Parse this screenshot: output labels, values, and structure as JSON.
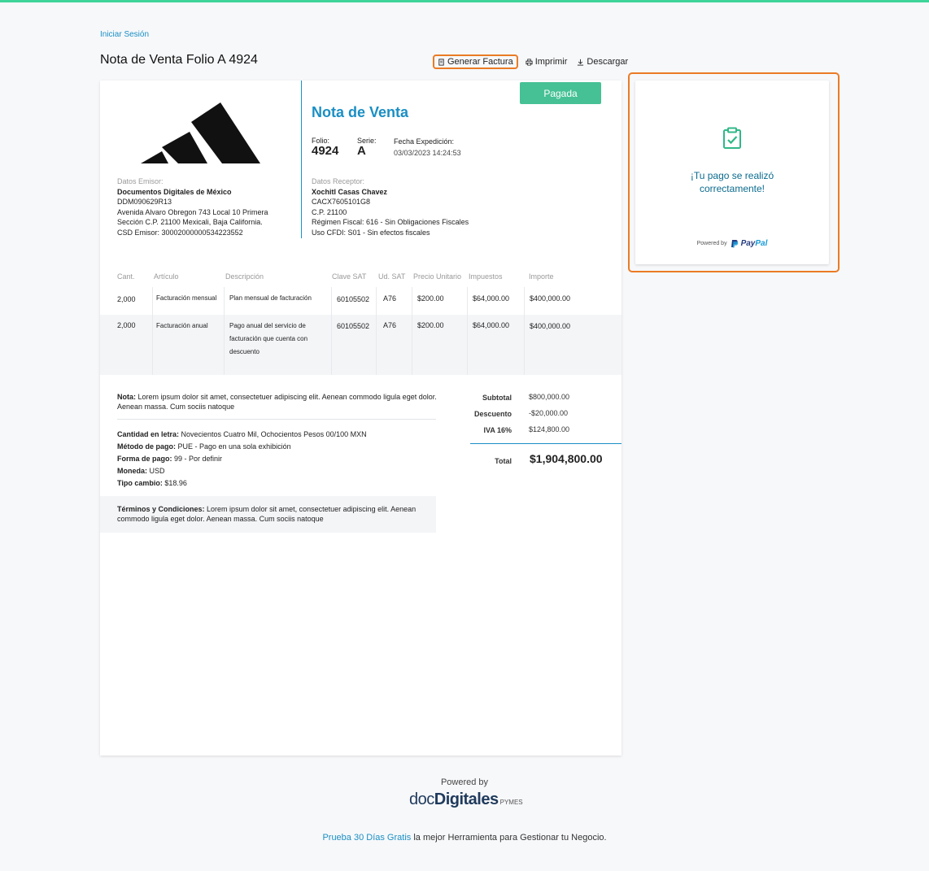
{
  "header": {
    "login_link": "Iniciar Sesión",
    "title": "Nota de Venta Folio A 4924",
    "actions": {
      "generate_invoice": "Generar Factura",
      "print": "Imprimir",
      "download": "Descargar"
    }
  },
  "colors": {
    "accent": "#1a8fc4",
    "status_green": "#45c195",
    "highlight": "#ea7b25",
    "top_bar": "#3ed49a"
  },
  "document": {
    "status_badge": "Pagada",
    "heading": "Nota de Venta",
    "folio_label": "Folio:",
    "folio": "4924",
    "serie_label": "Serie:",
    "serie": "A",
    "date_label": "Fecha Expedición:",
    "date": "03/03/2023 14:24:53",
    "emisor": {
      "label": "Datos Emisor:",
      "name": "Documentos Digitales de México",
      "rfc": "DDM090629R13",
      "address1": "Avenida Alvaro Obregon 743 Local 10 Primera",
      "address2": "Sección C.P. 21100 Mexicali, Baja California.",
      "csd": "CSD Emisor: 30002000000534223552"
    },
    "receptor": {
      "label": "Datos Receptor:",
      "name": "Xochitl Casas Chavez",
      "rfc": "CACX7605101G8",
      "cp": "C.P. 21100",
      "regimen": "Régimen Fiscal: 616 - Sin Obligaciones Fiscales",
      "uso": "Uso CFDI: S01 - Sin efectos fiscales"
    },
    "table": {
      "headers": [
        "Cant.",
        "Artículo",
        "Descripción",
        "Clave SAT",
        "Ud. SAT",
        "Precio Unitario",
        "Impuestos",
        "Importe"
      ],
      "rows": [
        {
          "cant": "2,000",
          "articulo": "Facturación mensual",
          "descripcion": "Plan mensual de facturación",
          "clave": "60105502",
          "unidad": "A76",
          "precio": "$200.00",
          "impuestos": "$64,000.00",
          "importe": "$400,000.00"
        },
        {
          "cant": "2,000",
          "articulo": "Facturación anual",
          "descripcion1": "Pago anual del servicio de",
          "descripcion2": "facturación que cuenta con",
          "descripcion3": "descuento",
          "clave": "60105502",
          "unidad": "A76",
          "precio": "$200.00",
          "impuestos": "$64,000.00",
          "importe": "$400,000.00"
        }
      ]
    },
    "note": {
      "label": "Nota:",
      "text": "Lorem ipsum dolor sit amet, consectetuer adipiscing elit. Aenean commodo ligula eget dolor. Aenean massa. Cum sociis natoque"
    },
    "info": {
      "amount_words_label": "Cantidad en letra:",
      "amount_words": "Novecientos Cuatro Mil, Ochocientos Pesos 00/100 MXN",
      "payment_method_label": "Método de pago:",
      "payment_method": "PUE - Pago en una sola exhibición",
      "payment_form_label": "Forma de pago:",
      "payment_form": "99 - Por definir",
      "currency_label": "Moneda:",
      "currency": "USD",
      "exchange_label": "Tipo cambio:",
      "exchange": "$18.96"
    },
    "terms": {
      "label": "Términos y Condiciones:",
      "text": "Lorem ipsum dolor sit amet, consectetuer adipiscing elit. Aenean commodo ligula eget dolor. Aenean massa. Cum sociis natoque"
    },
    "totals": {
      "subtotal_label": "Subtotal",
      "subtotal": "$800,000.00",
      "discount_label": "Descuento",
      "discount": "-$20,000.00",
      "iva_label": "IVA 16%",
      "iva": "$124,800.00",
      "total_label": "Total",
      "total": "$1,904,800.00"
    }
  },
  "payment_card": {
    "icon": "clipboard-check-icon",
    "message_line1": "¡Tu pago se realizó",
    "message_line2": "correctamente!",
    "powered_by": "Powered by",
    "paypal_part1": "Pay",
    "paypal_part2": "Pal"
  },
  "footer": {
    "powered_by": "Powered by",
    "brand_part1": "doc",
    "brand_part2": "Digitales",
    "brand_suffix": "PYMES",
    "trial_link": "Prueba 30 Días Gratis",
    "tagline": " la mejor Herramienta para Gestionar tu Negocio."
  }
}
